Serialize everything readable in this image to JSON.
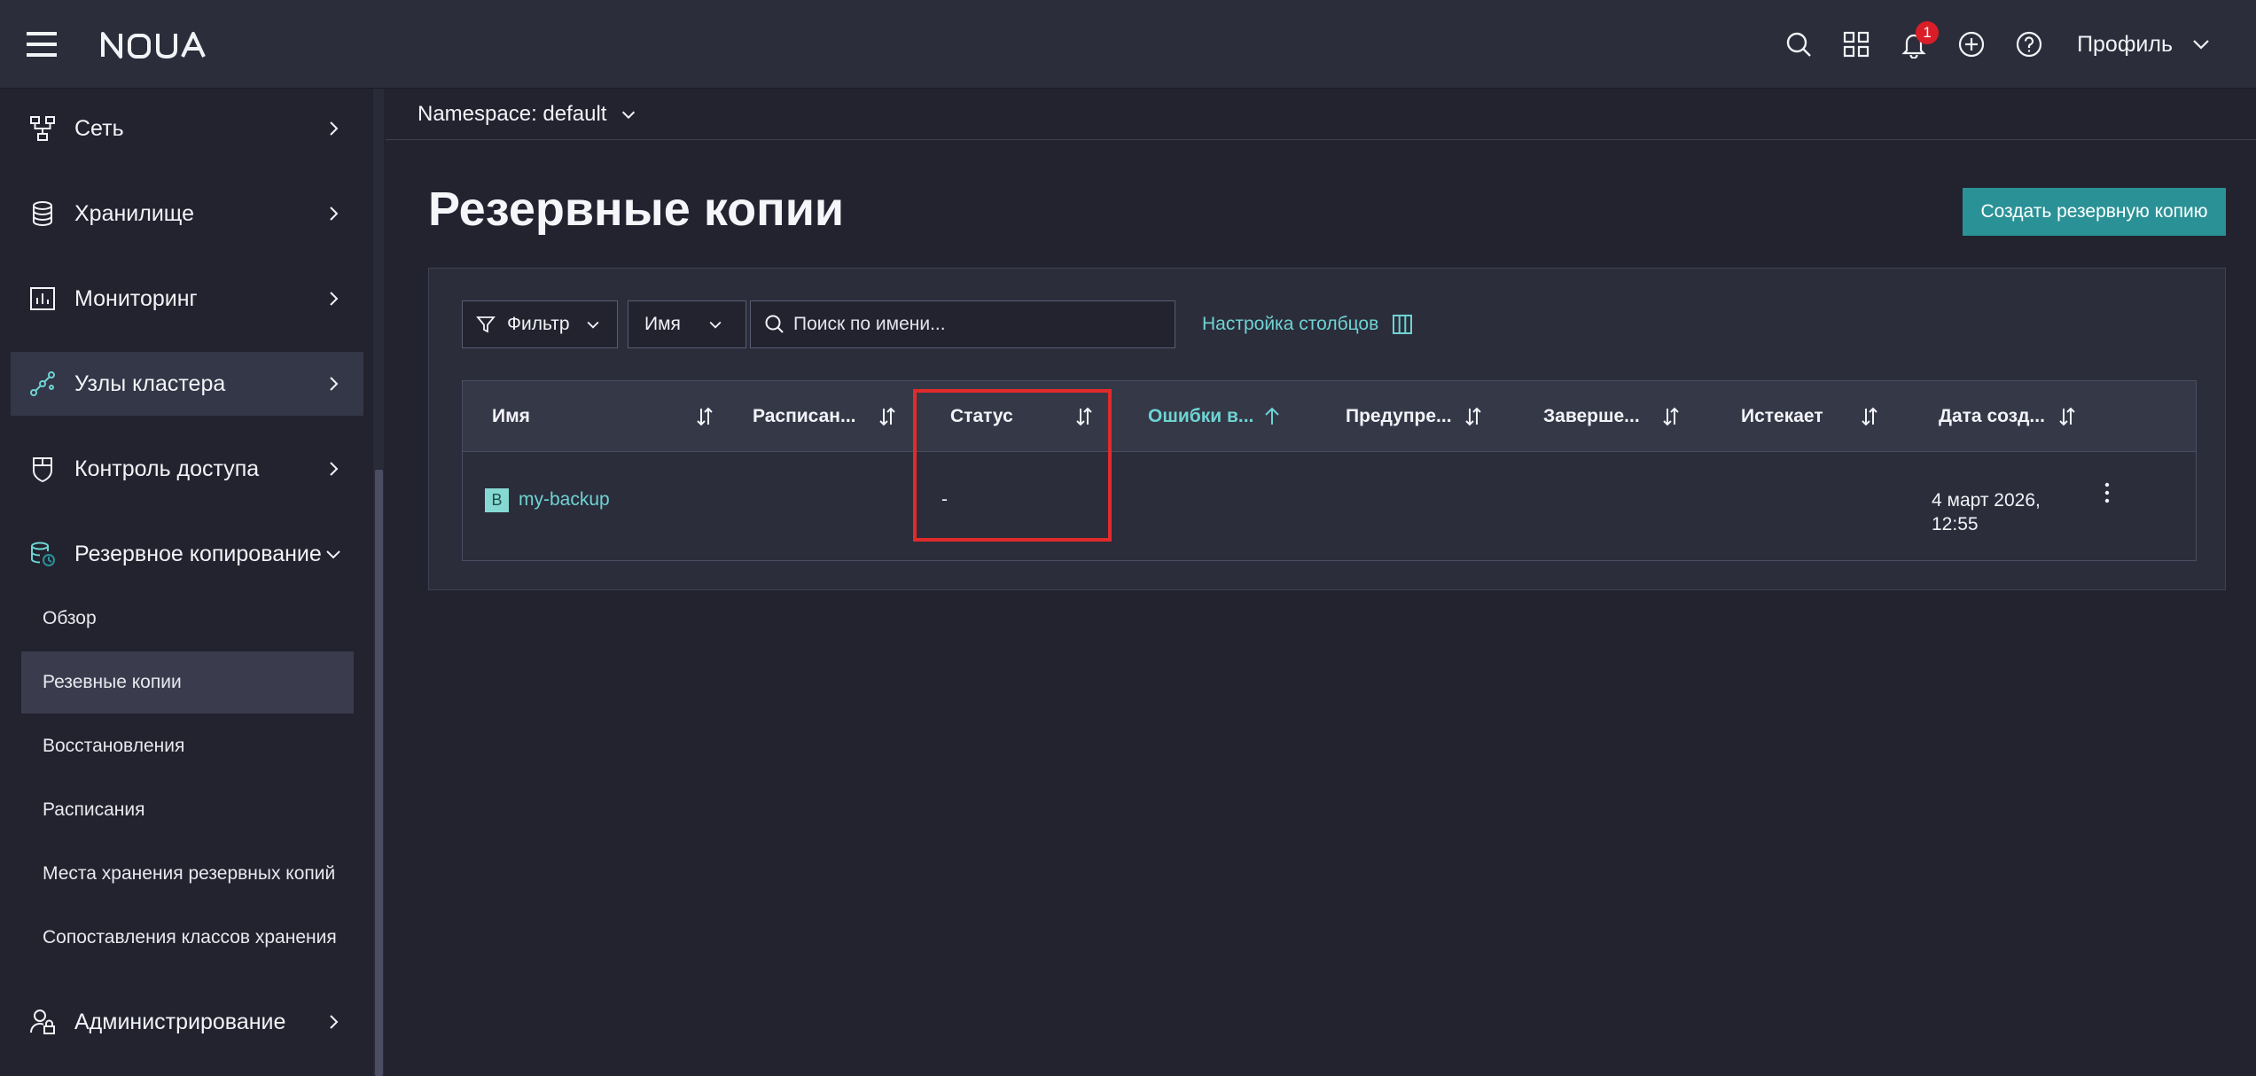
{
  "header": {
    "brand": "NOUA",
    "notifications_count": "1",
    "profile_label": "Профиль"
  },
  "sidebar": {
    "items": [
      {
        "label": "Сеть",
        "icon": "network-icon"
      },
      {
        "label": "Хранилище",
        "icon": "database-icon"
      },
      {
        "label": "Мониторинг",
        "icon": "chart-icon"
      },
      {
        "label": "Узлы кластера",
        "icon": "cluster-nodes-icon",
        "active": true
      },
      {
        "label": "Контроль доступа",
        "icon": "shield-icon"
      },
      {
        "label": "Резервное копирование",
        "icon": "backup-icon",
        "expanded": true
      },
      {
        "label": "Администрирование",
        "icon": "admin-icon"
      }
    ],
    "backup_sub_items": [
      {
        "label": "Обзор"
      },
      {
        "label": "Резевные копии",
        "active": true
      },
      {
        "label": "Восстановления"
      },
      {
        "label": "Расписания"
      },
      {
        "label": "Места хранения резервных копий"
      },
      {
        "label": "Сопоставления классов хранения"
      }
    ]
  },
  "namespace": {
    "label": "Namespace: default"
  },
  "page": {
    "title": "Резервные копии",
    "create_button": "Создать резервную копию"
  },
  "toolbar": {
    "filter_label": "Фильтр",
    "field_select": "Имя",
    "search_placeholder": "Поиск по имени...",
    "columns_link": "Настройка столбцов"
  },
  "table": {
    "columns": [
      {
        "label": "Имя",
        "sorted": false
      },
      {
        "label": "Расписан...",
        "sorted": false
      },
      {
        "label": "Статус",
        "sorted": false
      },
      {
        "label": "Ошибки в...",
        "sorted": true,
        "direction": "asc"
      },
      {
        "label": "Предупре...",
        "sorted": false
      },
      {
        "label": "Заверше...",
        "sorted": false
      },
      {
        "label": "Истекает",
        "sorted": false
      },
      {
        "label": "Дата созд...",
        "sorted": false
      }
    ],
    "rows": [
      {
        "type_badge": "B",
        "name": "my-backup",
        "schedule": "",
        "status": "-",
        "errors": "",
        "warnings": "",
        "completed": "",
        "expires": "",
        "created": "4 март 2026, 12:55"
      }
    ]
  },
  "colors": {
    "accent": "#2a9296",
    "link": "#6fd3d3",
    "highlight": "#e12b2b",
    "badge": "#da1e28"
  }
}
